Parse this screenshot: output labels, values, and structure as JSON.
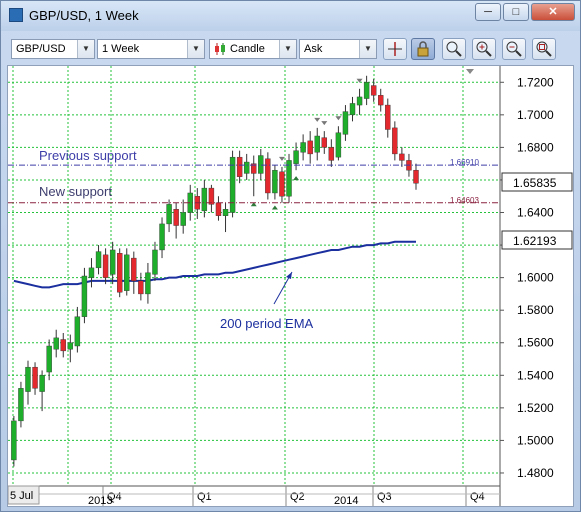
{
  "window": {
    "title": "GBP/USD,  1 Week",
    "minimize_label": "─",
    "maximize_label": "□",
    "close_label": "✕"
  },
  "toolbar": {
    "symbol": "GBP/USD",
    "timeframe": "1 Week",
    "chart_type": "Candle",
    "price_type": "Ask",
    "buttons": [
      "crosshair-icon",
      "lock-icon",
      "magnify-icon",
      "zoom-in-icon",
      "zoom-out-icon",
      "zoom-fit-icon"
    ]
  },
  "colors": {
    "bull": "#1fae2c",
    "bear": "#e3282e",
    "ema": "#1b2f9e",
    "grid": "#23c23a",
    "previous_support": "#3d3da8",
    "new_support": "#8a2240"
  },
  "annotations": {
    "previous_support": "Previous support",
    "new_support": "New support",
    "ema": "200 period EMA"
  },
  "levels": {
    "previous_support": "1.66910",
    "new_support": "1.64603",
    "current_price": "1.65835",
    "ema_value": "1.62193"
  },
  "time_axis": {
    "start_label": "5 Jul",
    "quarters": [
      "Q4",
      "Q1",
      "Q2",
      "Q3",
      "Q4"
    ],
    "years": [
      "2013",
      "2014"
    ]
  },
  "chart_data": {
    "type": "candlestick",
    "title": "GBP/USD, 1 Week",
    "ylim": [
      1.47,
      1.73
    ],
    "y_ticks": [
      "1.7200",
      "1.7000",
      "1.6800",
      "1.6600",
      "1.6400",
      "1.6200",
      "1.6000",
      "1.5800",
      "1.5600",
      "1.5400",
      "1.5200",
      "1.5000",
      "1.4800"
    ],
    "candles": [
      [
        1.488,
        1.512,
        1.484,
        1.515
      ],
      [
        1.512,
        1.532,
        1.508,
        1.536
      ],
      [
        1.53,
        1.545,
        1.522,
        1.549
      ],
      [
        1.545,
        1.532,
        1.528,
        1.548
      ],
      [
        1.53,
        1.54,
        1.518,
        1.543
      ],
      [
        1.542,
        1.558,
        1.537,
        1.562
      ],
      [
        1.556,
        1.563,
        1.551,
        1.568
      ],
      [
        1.562,
        1.555,
        1.551,
        1.566
      ],
      [
        1.556,
        1.56,
        1.548,
        1.565
      ],
      [
        1.558,
        1.576,
        1.554,
        1.582
      ],
      [
        1.576,
        1.601,
        1.572,
        1.606
      ],
      [
        1.6,
        1.606,
        1.594,
        1.612
      ],
      [
        1.606,
        1.616,
        1.602,
        1.62
      ],
      [
        1.614,
        1.6,
        1.596,
        1.618
      ],
      [
        1.602,
        1.617,
        1.596,
        1.622
      ],
      [
        1.615,
        1.591,
        1.588,
        1.618
      ],
      [
        1.592,
        1.614,
        1.589,
        1.618
      ],
      [
        1.612,
        1.598,
        1.59,
        1.616
      ],
      [
        1.598,
        1.59,
        1.586,
        1.603
      ],
      [
        1.59,
        1.603,
        1.584,
        1.609
      ],
      [
        1.602,
        1.617,
        1.598,
        1.622
      ],
      [
        1.617,
        1.633,
        1.612,
        1.637
      ],
      [
        1.633,
        1.645,
        1.628,
        1.648
      ],
      [
        1.642,
        1.632,
        1.624,
        1.646
      ],
      [
        1.632,
        1.64,
        1.627,
        1.648
      ],
      [
        1.64,
        1.652,
        1.635,
        1.657
      ],
      [
        1.65,
        1.642,
        1.636,
        1.655
      ],
      [
        1.641,
        1.655,
        1.637,
        1.66
      ],
      [
        1.655,
        1.645,
        1.64,
        1.657
      ],
      [
        1.646,
        1.638,
        1.635,
        1.65
      ],
      [
        1.638,
        1.642,
        1.628,
        1.646
      ],
      [
        1.64,
        1.674,
        1.637,
        1.678
      ],
      [
        1.674,
        1.662,
        1.658,
        1.678
      ],
      [
        1.664,
        1.671,
        1.66,
        1.676
      ],
      [
        1.67,
        1.664,
        1.65,
        1.675
      ],
      [
        1.664,
        1.675,
        1.66,
        1.679
      ],
      [
        1.673,
        1.652,
        1.648,
        1.677
      ],
      [
        1.652,
        1.666,
        1.648,
        1.669
      ],
      [
        1.665,
        1.65,
        1.646,
        1.668
      ],
      [
        1.65,
        1.672,
        1.646,
        1.676
      ],
      [
        1.67,
        1.678,
        1.666,
        1.683
      ],
      [
        1.677,
        1.683,
        1.672,
        1.688
      ],
      [
        1.684,
        1.676,
        1.67,
        1.69
      ],
      [
        1.677,
        1.687,
        1.672,
        1.692
      ],
      [
        1.686,
        1.68,
        1.676,
        1.69
      ],
      [
        1.68,
        1.672,
        1.668,
        1.685
      ],
      [
        1.674,
        1.689,
        1.672,
        1.693
      ],
      [
        1.688,
        1.702,
        1.684,
        1.706
      ],
      [
        1.7,
        1.707,
        1.696,
        1.711
      ],
      [
        1.706,
        1.711,
        1.7,
        1.716
      ],
      [
        1.71,
        1.72,
        1.706,
        1.724
      ],
      [
        1.718,
        1.712,
        1.708,
        1.722
      ],
      [
        1.712,
        1.706,
        1.702,
        1.716
      ],
      [
        1.706,
        1.691,
        1.686,
        1.71
      ],
      [
        1.692,
        1.676,
        1.672,
        1.696
      ],
      [
        1.676,
        1.672,
        1.668,
        1.68
      ],
      [
        1.672,
        1.666,
        1.662,
        1.676
      ],
      [
        1.666,
        1.658,
        1.654,
        1.67
      ]
    ],
    "candle_fields": [
      "open",
      "close",
      "low",
      "high"
    ],
    "ema_200": [
      1.598,
      1.597,
      1.596,
      1.595,
      1.594,
      1.594,
      1.595,
      1.596,
      1.596,
      1.596,
      1.597,
      1.598,
      1.598,
      1.598,
      1.598,
      1.598,
      1.598,
      1.598,
      1.598,
      1.598,
      1.599,
      1.599,
      1.6,
      1.6,
      1.601,
      1.601,
      1.601,
      1.602,
      1.602,
      1.602,
      1.603,
      1.603,
      1.604,
      1.605,
      1.606,
      1.607,
      1.608,
      1.609,
      1.61,
      1.611,
      1.612,
      1.613,
      1.614,
      1.615,
      1.616,
      1.617,
      1.617,
      1.618,
      1.619,
      1.619,
      1.62,
      1.62,
      1.621,
      1.621,
      1.622,
      1.622,
      1.622,
      1.622
    ]
  }
}
